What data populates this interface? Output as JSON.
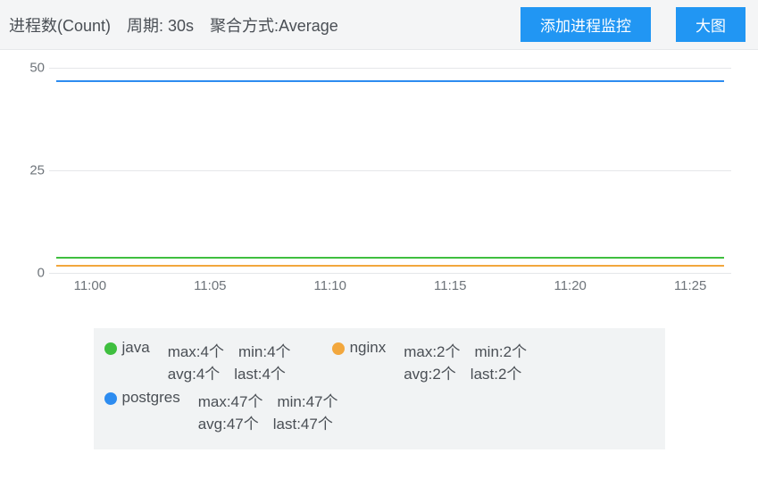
{
  "header": {
    "title": "进程数(Count)",
    "period_label": "周期: 30s",
    "agg_label": "聚合方式:Average",
    "add_button": "添加进程监控",
    "big_button": "大图"
  },
  "chart_data": {
    "type": "line",
    "title": "进程数(Count)",
    "xlabel": "",
    "ylabel": "",
    "ylim": [
      0,
      50
    ],
    "y_ticks": [
      0,
      25,
      50
    ],
    "categories": [
      "11:00",
      "11:05",
      "11:10",
      "11:15",
      "11:20",
      "11:25"
    ],
    "series": [
      {
        "name": "java",
        "color": "#3fbf3f",
        "values": [
          4,
          4,
          4,
          4,
          4,
          4
        ]
      },
      {
        "name": "nginx",
        "color": "#f2a73d",
        "values": [
          2,
          2,
          2,
          2,
          2,
          2
        ]
      },
      {
        "name": "postgres",
        "color": "#2d8cf0",
        "values": [
          47,
          47,
          47,
          47,
          47,
          47
        ]
      }
    ],
    "stats_unit": "个",
    "legend_stats": {
      "java": {
        "max": 4,
        "min": 4,
        "avg": 4,
        "last": 4
      },
      "nginx": {
        "max": 2,
        "min": 2,
        "avg": 2,
        "last": 2
      },
      "postgres": {
        "max": 47,
        "min": 47,
        "avg": 47,
        "last": 47
      }
    }
  }
}
